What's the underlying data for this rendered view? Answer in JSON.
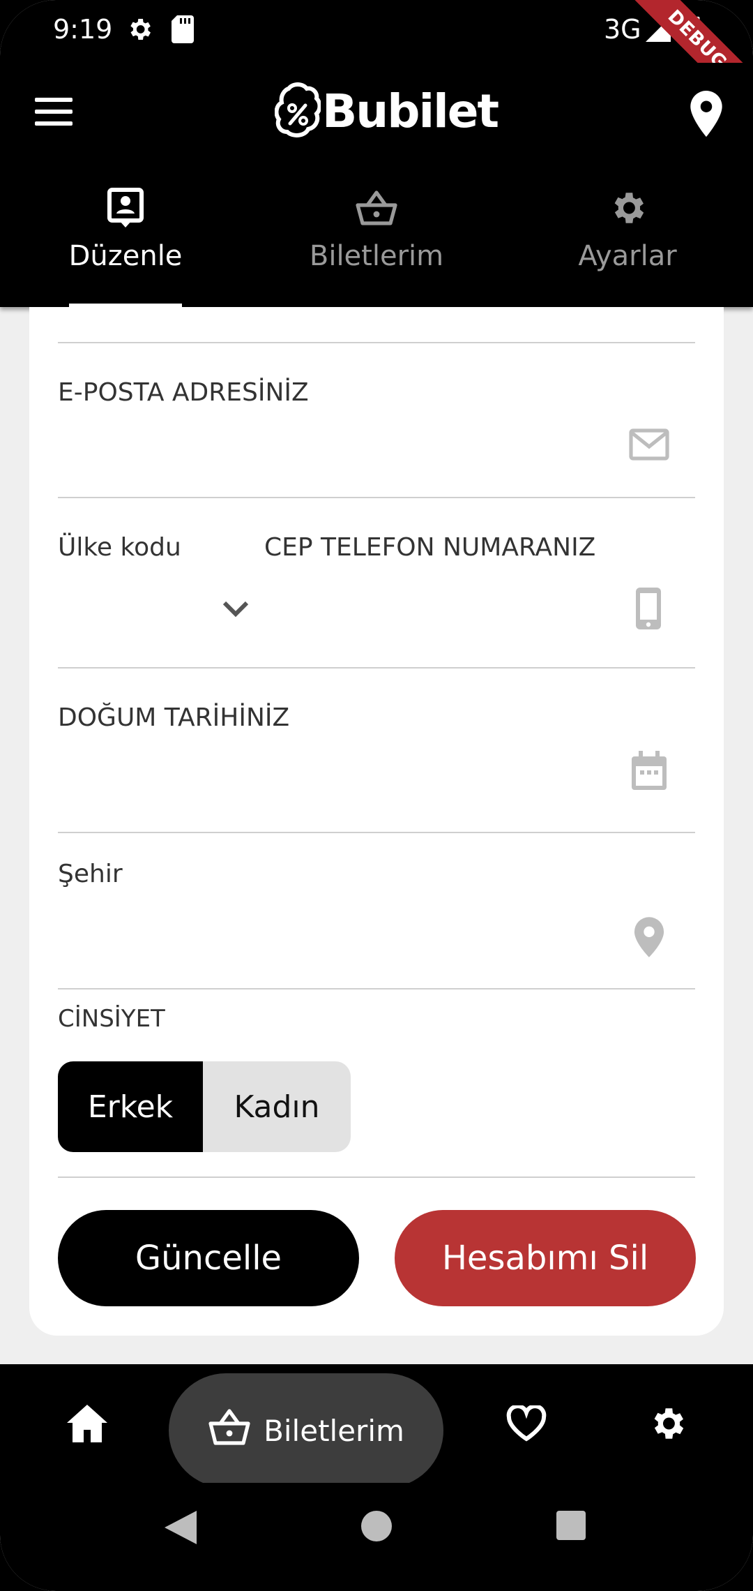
{
  "status_bar": {
    "time": "9:19",
    "network": "3G",
    "debug_ribbon": "DEBUG",
    "icons": [
      "settings-icon",
      "sd-card-icon",
      "signal-icon",
      "battery-icon"
    ]
  },
  "app_bar": {
    "logo_text": "Bubilet",
    "icons": [
      "menu-icon",
      "location-pin-icon"
    ]
  },
  "tabs": [
    {
      "label": "Düzenle",
      "icon": "profile-edit-icon",
      "active": true
    },
    {
      "label": "Biletlerim",
      "icon": "basket-icon",
      "active": false
    },
    {
      "label": "Ayarlar",
      "icon": "gear-icon",
      "active": false
    }
  ],
  "form": {
    "email": {
      "label": "E-POSTA ADRESİNİZ",
      "value": "",
      "icon": "mail-icon"
    },
    "country_code": {
      "label": "Ülke kodu",
      "value": "",
      "icon": "chevron-down-icon"
    },
    "phone": {
      "label": "CEP TELEFON NUMARANIZ",
      "value": "",
      "icon": "phone-icon"
    },
    "birth_date": {
      "label": "DOĞUM TARİHİNİZ",
      "value": "",
      "icon": "calendar-icon"
    },
    "city": {
      "label": "Şehir",
      "value": "",
      "icon": "location-icon"
    },
    "gender": {
      "label": "CİNSİYET",
      "options": [
        "Erkek",
        "Kadın"
      ],
      "selected": "Erkek"
    },
    "update_button": "Güncelle",
    "delete_button": "Hesabımı Sil"
  },
  "bottom_nav": {
    "items": [
      "home-icon",
      "basket-icon",
      "heart-icon",
      "gear-icon"
    ],
    "active_label": "Biletlerim"
  },
  "colors": {
    "accent_red": "#b83434",
    "background": "#000000",
    "card": "#ffffff",
    "muted_icon": "#bdbdbd"
  }
}
